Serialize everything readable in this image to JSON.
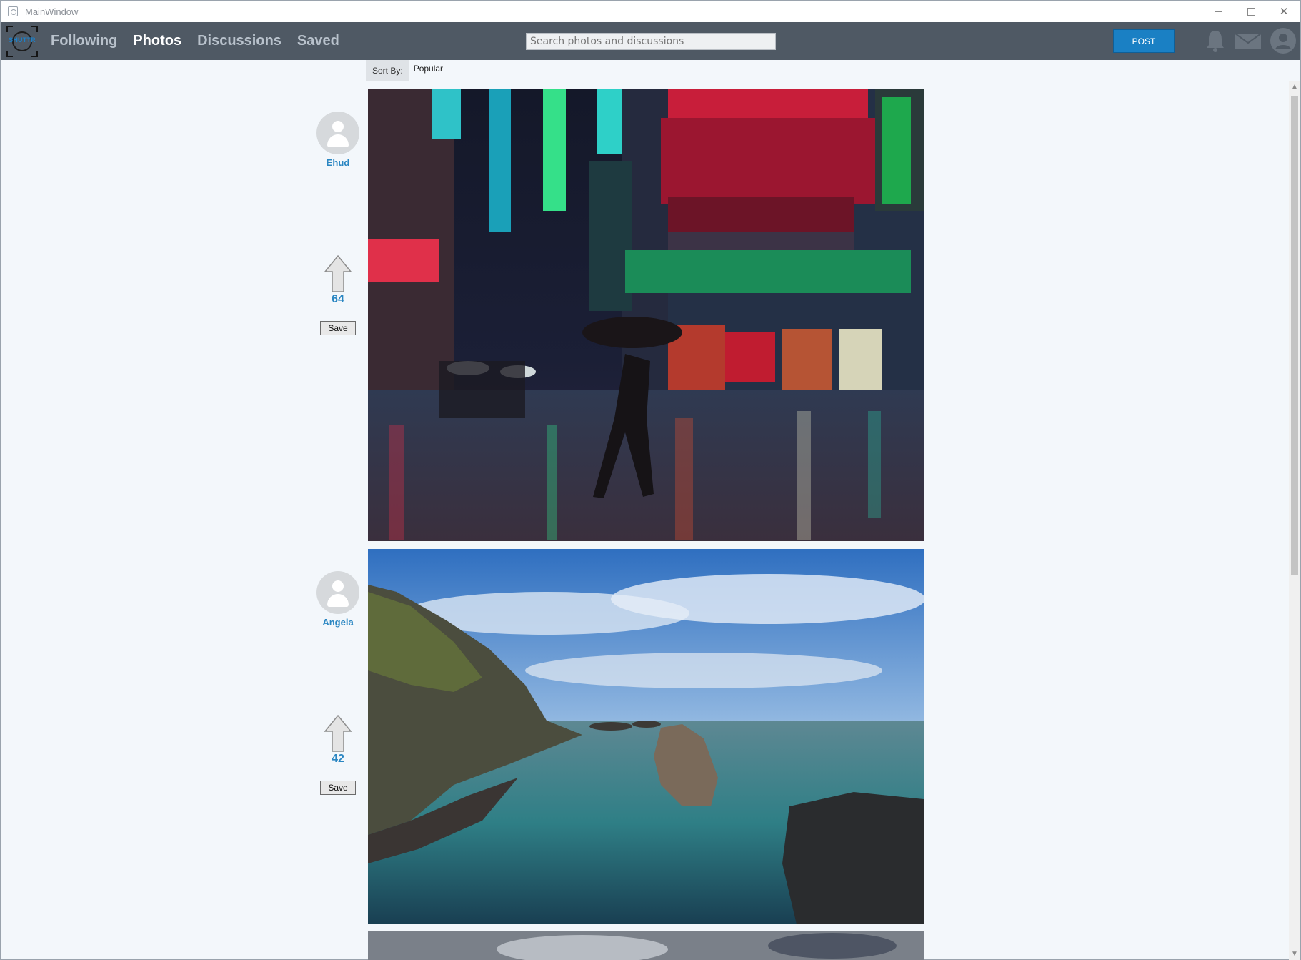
{
  "window": {
    "title": "MainWindow"
  },
  "nav": {
    "logo_text": "SHUTTR",
    "links": [
      "Following",
      "Photos",
      "Discussions",
      "Saved"
    ],
    "active": "Photos",
    "search_placeholder": "Search photos and discussions",
    "post_label": "POST",
    "icons": [
      "bell-icon",
      "mail-icon",
      "profile-icon"
    ]
  },
  "sort": {
    "label": "Sort By:",
    "value": "Popular"
  },
  "posts": [
    {
      "user": "Ehud",
      "votes": "64",
      "save_label": "Save",
      "photo": "night-street-neon"
    },
    {
      "user": "Angela",
      "votes": "42",
      "save_label": "Save",
      "photo": "coastal-cliffs-sea"
    }
  ],
  "colors": {
    "navbar": "#4f5964",
    "accent": "#1a80c4",
    "username": "#2a86c2",
    "background": "#f3f7fb"
  }
}
